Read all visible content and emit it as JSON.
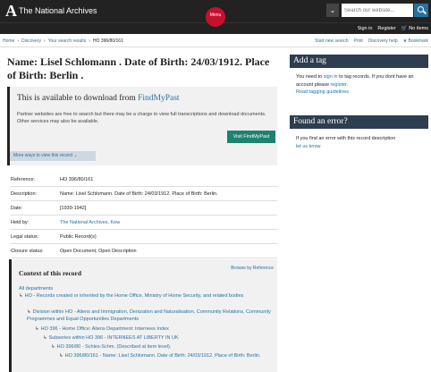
{
  "header": {
    "logo_glyph": "A",
    "logo_text": "The National Archives",
    "menu_label": "Menu",
    "search_toggle_icon": "chevron-down-icon",
    "search_placeholder": "Search our website...",
    "search_icon": "search-icon"
  },
  "account": {
    "sign_in": "Sign in",
    "register": "Register",
    "basket": "No items"
  },
  "breadcrumbs": {
    "items": [
      "Home",
      "Discovery",
      "Your search results",
      "HO 396/80/161"
    ],
    "tools": {
      "new_search": "Start new search",
      "print": "Print",
      "help": "Discovery help",
      "bookmark": "Bookmark"
    }
  },
  "record": {
    "title": "Name: Lisel Schlomann . Date of Birth: 24/03/1912. Place of Birth: Berlin ."
  },
  "download": {
    "heading_prefix": "This is available to download from ",
    "heading_link": "FindMyPast",
    "text": "Partner websites are free to search but there may be a charge to view full transcriptions and download documents. Other services may also be available.",
    "button": "Visit FindMyPast",
    "more_ways": "More ways to view this record"
  },
  "details": {
    "rows": [
      {
        "label": "Reference:",
        "value": "HO 396/80/161"
      },
      {
        "label": "Description:",
        "value": "Name: Lisel Schlomann. Date of Birth: 24/03/1912. Place of Birth: Berlin."
      },
      {
        "label": "Date:",
        "value": "[1939-1942]"
      },
      {
        "label": "Held by:",
        "value": "The National Archives, Kew"
      },
      {
        "label": "Legal status:",
        "value": "Public Record(s)"
      },
      {
        "label": "Closure status:",
        "value": "Open Document, Open Description"
      }
    ]
  },
  "context": {
    "title": "Context of this record",
    "browse": "Browse by Reference",
    "items": [
      "All departments",
      "HO - Records created or inherited by the Home Office, Ministry of Home Security, and related bodies",
      "Division within HO - Aliens and Immigration, Denization and Naturalisation, Community Relations, Community Programmes and Equal Opportunities Departments",
      "HO 396 - Home Office: Aliens Department: Internees Index",
      "Subseries within HO 396 - INTERNEES AT LIBERTY IN UK",
      "HO 396/80 - Schles-Schm. (Described at item level).",
      "HO 396/80/161 - Name: Lisel Schlomann. Date of Birth: 24/03/1912. Place of Birth: Berlin."
    ]
  },
  "sidebar": {
    "tag": {
      "heading": "Add a tag",
      "text_a": "You need to ",
      "sign_in": "sign in",
      "text_b": " to tag records. If you dont have an account please ",
      "register": "register",
      "text_c": ".",
      "guidelines": "Read tagging guidelines"
    },
    "error": {
      "heading": "Found an error?",
      "text": "If you find an error with this record description",
      "link": "let us know"
    }
  },
  "colors": {
    "header_bg": "#222222",
    "menu_red": "#c8102e",
    "link_blue": "#26729e",
    "button_green": "#1d8270",
    "sidebar_head": "#2c3e50"
  }
}
